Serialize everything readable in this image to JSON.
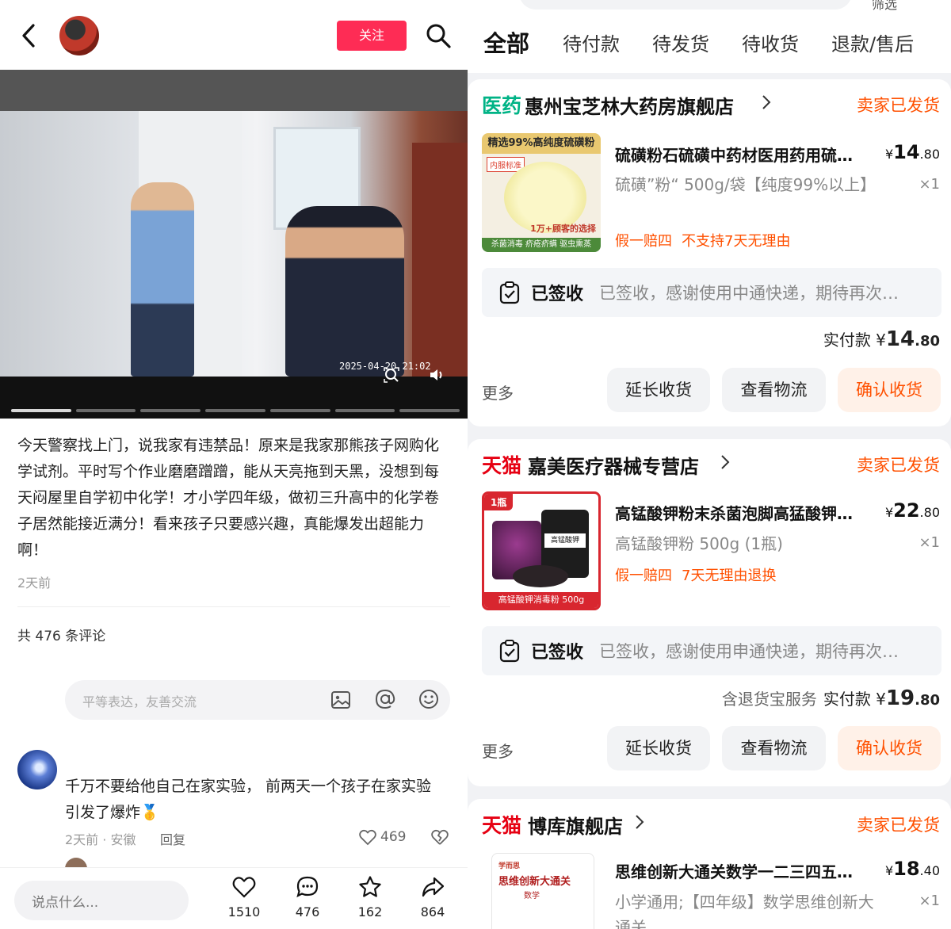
{
  "left": {
    "follow_label": "关注",
    "video_time": "2025-04-20 21:02",
    "post_text": "今天警察找上门，说我家有违禁品！原来是我家那熊孩子网购化学试剂。平时写个作业磨磨蹭蹭，能从天亮拖到天黑，没想到每天闷屋里自学初中化学！才小学四年级，做初三升高中的化学卷子居然能接近满分！看来孩子只要感兴趣，真能爆发出超能力啊！",
    "post_time": "2天前",
    "comment_count": "共 476 条评论",
    "comment_placeholder": "平等表达，友善交流",
    "comment": {
      "text": "千万不要给他自己在家实验， 前两天一个孩子在家实验引发了爆炸🥇",
      "meta": "2天前 · 安徽",
      "reply": "回复",
      "likes": "469"
    },
    "bottom": {
      "say_placeholder": "说点什么...",
      "likes": "1510",
      "comments": "476",
      "favorites": "162",
      "shares": "864"
    }
  },
  "right": {
    "filter_label": "筛选",
    "tabs": [
      "全部",
      "待付款",
      "待发货",
      "待收货",
      "退款/售后"
    ],
    "orders": [
      {
        "shop_tag": "医药",
        "shop_name": "惠州宝芝林大药房旗舰店",
        "status": "卖家已发货",
        "title": "硫磺粉石硫磺中药材医用药用硫…",
        "price_int": "14",
        "price_dec": ".80",
        "sku": "硫磺”粉“ 500g/袋【纯度99%以上】",
        "qty": "×1",
        "tags": [
          "假一赔四",
          "不支持7天无理由"
        ],
        "sign_label": "已签收",
        "sign_msg": "已签收，感谢使用中通快递，期待再次…",
        "service": "",
        "paid_label": "实付款",
        "paid_int": "14",
        "paid_dec": ".80",
        "thumb_top": "精选99%高纯度硫磺粉",
        "thumb_badge": "内服标准",
        "thumb_mid": "1万+顾客的选择",
        "thumb_bottom": "杀菌消毒 疥疮疥螨 驱虫熏蒸"
      },
      {
        "shop_tag": "天猫",
        "shop_name": "嘉美医疗器械专营店",
        "status": "卖家已发货",
        "title": "高锰酸钾粉末杀菌泡脚高猛酸钾…",
        "price_int": "22",
        "price_dec": ".80",
        "sku": "高锰酸钾粉 500g (1瓶)",
        "qty": "×1",
        "tags": [
          "假一赔四",
          "7天无理由退换"
        ],
        "sign_label": "已签收",
        "sign_msg": "已签收，感谢使用申通快递，期待再次…",
        "service": "含退货宝服务",
        "paid_label": "实付款",
        "paid_int": "19",
        "paid_dec": ".80",
        "thumb_badge": "1瓶",
        "thumb_label": "高锰酸钾",
        "thumb_bottom": "高锰酸钾消毒粉 500g"
      },
      {
        "shop_tag": "天猫",
        "shop_name": "博库旗舰店",
        "status": "卖家已发货",
        "title": "思维创新大通关数学一二三四五…",
        "price_int": "18",
        "price_dec": ".40",
        "sku": "小学通用;【四年级】数学思维创新大通关",
        "qty": "×1",
        "thumb_top": "学而思",
        "thumb_title": "思维创新大通关",
        "thumb_sub": "数学"
      }
    ],
    "actions": {
      "more": "更多",
      "extend": "延长收货",
      "logistics": "查看物流",
      "confirm": "确认收货"
    },
    "colors": {
      "accent": "#ff5000",
      "tmall": "#e60012",
      "pharma": "#00b386",
      "follow": "#fe2c55"
    }
  }
}
